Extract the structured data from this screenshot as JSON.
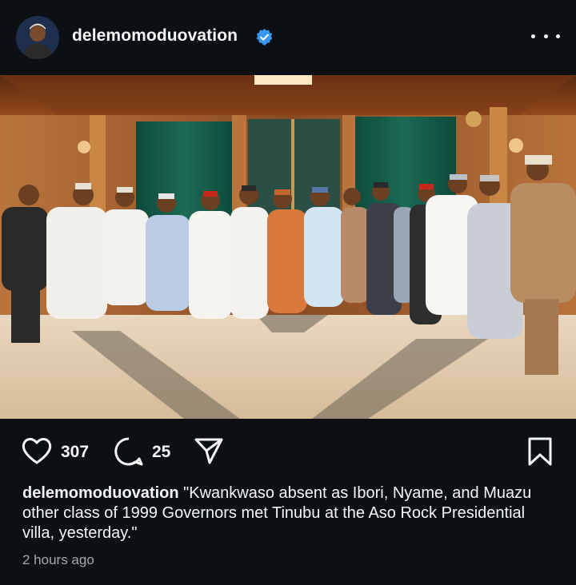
{
  "post": {
    "username": "delemomoduovation",
    "verified": true,
    "caption_user": "delemomoduovation",
    "caption_text": " \"Kwankwaso absent as Ibori, Nyame, and Muazu other class of 1999 Governors met Tinubu at the Aso Rock Presidential villa, yesterday.\"",
    "timestamp": "2 hours ago"
  },
  "actions": {
    "likes": "307",
    "comments": "25"
  },
  "icons": {
    "more": "more-options-icon",
    "like": "heart-icon",
    "comment": "comment-bubble-icon",
    "share": "share-paper-plane-icon",
    "save": "bookmark-icon",
    "verified": "verified-badge-icon"
  },
  "colors": {
    "background": "#0c1014",
    "text": "#f5f5f5",
    "muted": "#a8a8a8",
    "verified": "#3897f0"
  }
}
